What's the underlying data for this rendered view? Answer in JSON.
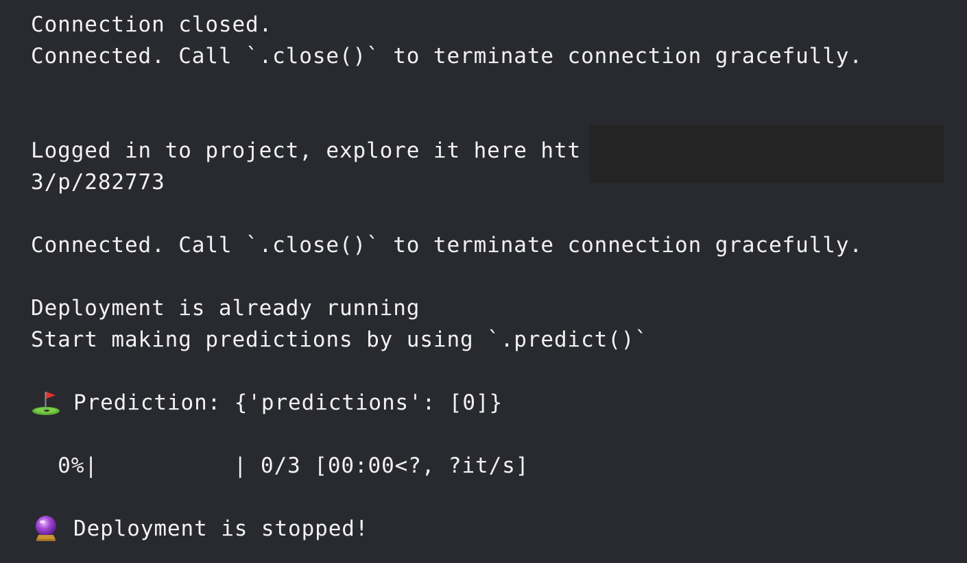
{
  "log": {
    "line1": "Connection closed.",
    "line2": "Connected. Call `.close()` to terminate connection gracefully.",
    "line3": "Logged in to project, explore it here htt",
    "line4": "3/p/282773",
    "line5": "Connected. Call `.close()` to terminate connection gracefully.",
    "line6": "Deployment is already running",
    "line7": "Start making predictions by using `.predict()`",
    "line8": "Prediction: {'predictions': [0]}",
    "progress": {
      "percent": "0%",
      "fraction": 0,
      "bar_left": "|",
      "bar_right": "|",
      "count": "0/3",
      "stats": "[00:00<?, ?it/s]"
    },
    "line10": "Deployment is stopped!"
  },
  "icons": {
    "prediction_icon": "golf-flag-icon",
    "stopped_icon": "crystal-ball-icon"
  },
  "colors": {
    "background": "#292a2f",
    "text": "#f2f2f2",
    "redaction": "#242424"
  }
}
